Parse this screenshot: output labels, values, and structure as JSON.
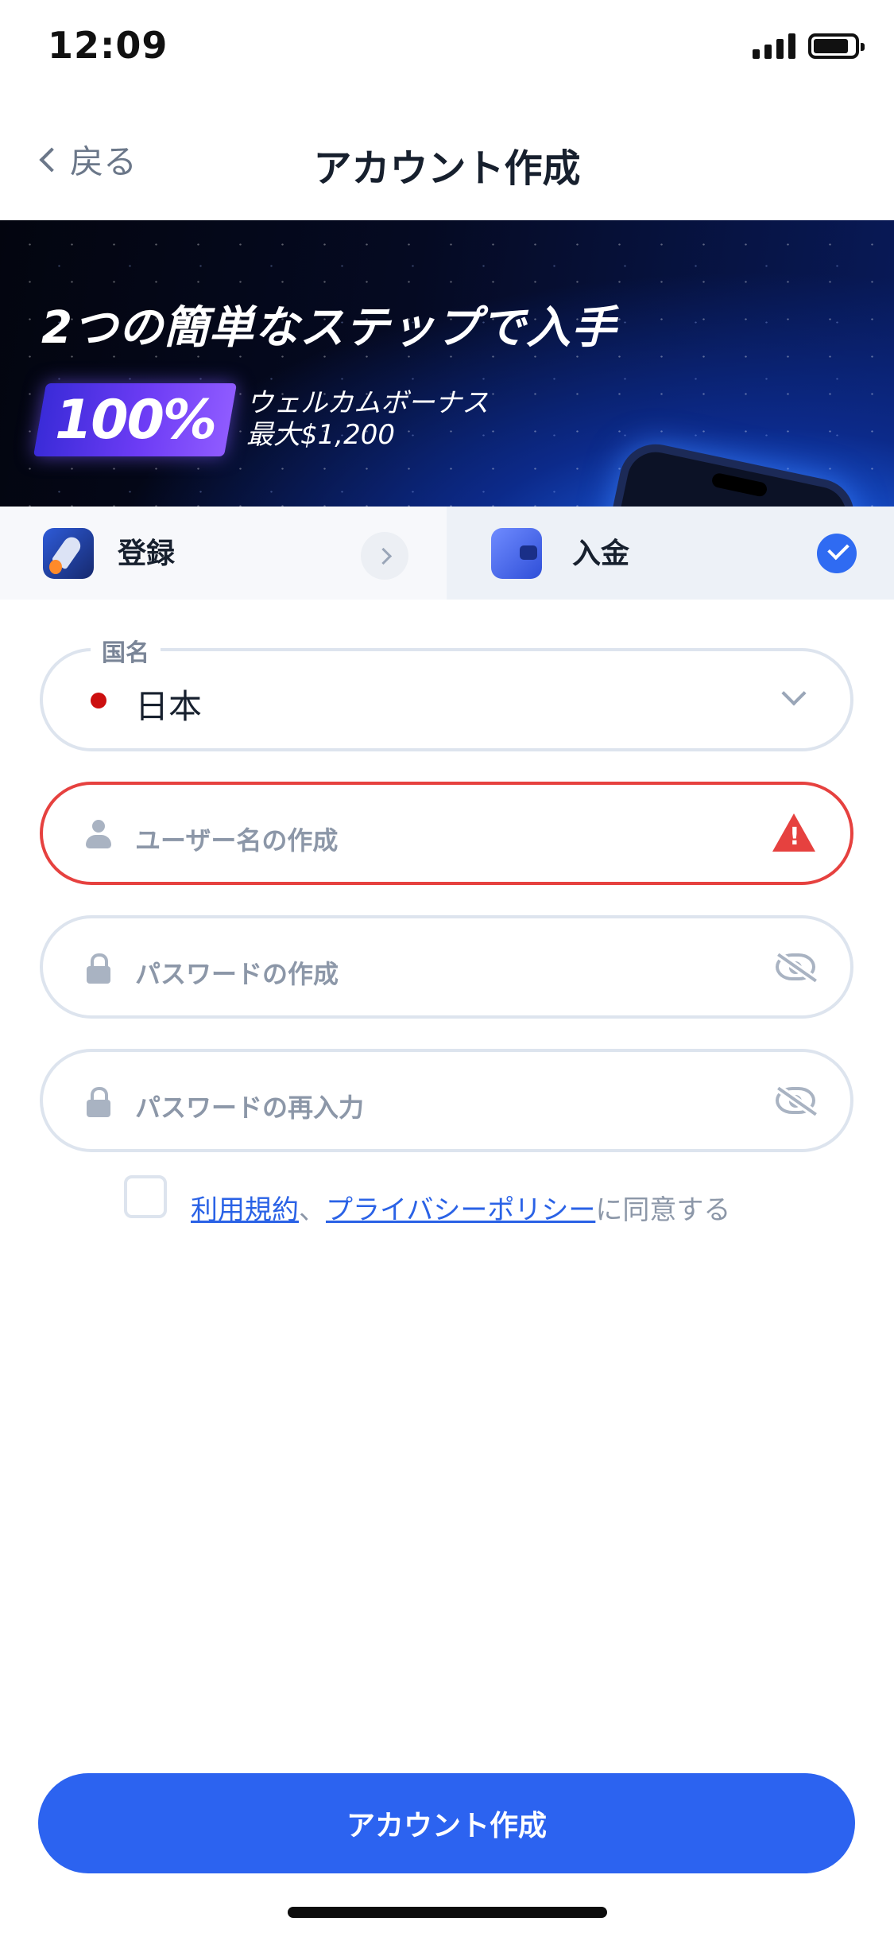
{
  "status_bar": {
    "time": "12:09"
  },
  "nav": {
    "back_label": "戻る",
    "title": "アカウント作成"
  },
  "banner": {
    "headline": "2つの簡単なステップで入手",
    "bonus_percent": "100%",
    "bonus_line1": "ウェルカムボーナス",
    "bonus_line2": "最大$1,200"
  },
  "steps": [
    {
      "label": "登録",
      "icon": "rocket-icon",
      "status": "current"
    },
    {
      "label": "入金",
      "icon": "wallet-icon",
      "status": "done"
    }
  ],
  "form": {
    "country": {
      "label": "国名",
      "value": "日本",
      "flag": "japan-flag-icon"
    },
    "username": {
      "placeholder": "ユーザー名の作成",
      "state": "error"
    },
    "password": {
      "placeholder": "パスワードの作成"
    },
    "password_confirm": {
      "placeholder": "パスワードの再入力"
    }
  },
  "terms": {
    "link_terms": "利用規約",
    "separator": "、",
    "link_privacy": "プライバシーポリシー",
    "suffix": "に同意する"
  },
  "cta": {
    "label": "アカウント作成"
  },
  "colors": {
    "accent": "#2c63f0",
    "error": "#e6413f",
    "border": "#dde4ee",
    "link": "#2a62e6"
  }
}
